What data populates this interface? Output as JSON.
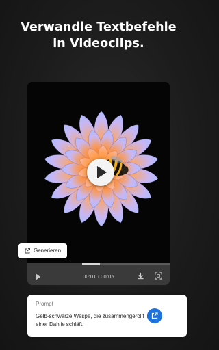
{
  "headline": {
    "line1": "Verwandle Textbefehle",
    "line2": "in Videoclips."
  },
  "player": {
    "time_current": "00:01",
    "time_separator": "/",
    "time_total": "00:05",
    "progress": 0.2,
    "icons": {
      "play": "play-icon",
      "download": "download-icon",
      "fullscreen": "fullscreen-icon",
      "center_play": "play-icon"
    }
  },
  "generate_button": {
    "label": "Generieren",
    "icon": "export-icon"
  },
  "prompt": {
    "label": "Prompt",
    "text": "Gelb-schwarze Wespe, die zusammengerollt in einer Dahlie schläft.",
    "send_icon": "export-icon"
  },
  "colors": {
    "accent": "#1f73e0",
    "background": "#1c1c1c",
    "petal_tip": "#b9c6ff",
    "petal_core": "#ff9a3c"
  }
}
